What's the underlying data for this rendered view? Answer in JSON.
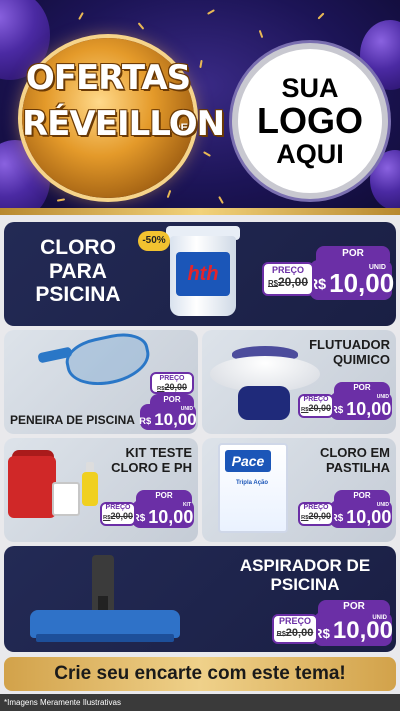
{
  "header": {
    "offer_line1": "OFERTAS",
    "offer_de": "DE",
    "offer_line2": "RÉVEILLON",
    "logo_line1": "SUA",
    "logo_line2": "LOGO",
    "logo_line3": "AQUI"
  },
  "products": {
    "cloro": {
      "title": "CLORO\nPARA\nPSICINA",
      "discount": "-50%",
      "brand": "hth",
      "old_label": "PREÇO",
      "old_currency": "R$",
      "old_price": "20,00",
      "por_label": "POR",
      "currency": "R$",
      "price": "10,00",
      "unit": "UNID"
    },
    "peneira": {
      "title": "PENEIRA DE PISCINA",
      "old_label": "PREÇO",
      "old_currency": "R$",
      "old_price": "20,00",
      "por_label": "POR",
      "currency": "R$",
      "price": "10,00",
      "unit": "UNID"
    },
    "flutuador": {
      "title": "FLUTUADOR\nQUIMICO",
      "old_label": "PREÇO",
      "old_currency": "R$",
      "old_price": "20,00",
      "por_label": "POR",
      "currency": "R$",
      "price": "10,00",
      "unit": "UNID"
    },
    "kit": {
      "title": "KIT TESTE\nCLORO E PH",
      "old_label": "PREÇO",
      "old_currency": "R$",
      "old_price": "20,00",
      "por_label": "POR",
      "currency": "R$",
      "price": "10,00",
      "unit": "KIT"
    },
    "pastilha": {
      "title": "CLORO EM\nPASTILHA",
      "brand": "Pace",
      "pack_text": "Tripla Ação",
      "old_label": "PREÇO",
      "old_currency": "R$",
      "old_price": "20,00",
      "por_label": "POR",
      "currency": "R$",
      "price": "10,00",
      "unit": "UNID"
    },
    "aspirador": {
      "title": "ASPIRADOR DE\nPSICINA",
      "old_label": "PREÇO",
      "old_currency": "R$",
      "old_price": "20,00",
      "por_label": "POR",
      "currency": "R$",
      "price": "10,00",
      "unit": "UNID"
    }
  },
  "cta": "Crie seu encarte com este tema!",
  "footnote": "*Imagens Meramente Ilustrativas",
  "colors": {
    "accent_purple": "#6b2fa6",
    "gold": "#e9b955",
    "dark_card": "#232a55",
    "light_card": "#dde3ea"
  }
}
